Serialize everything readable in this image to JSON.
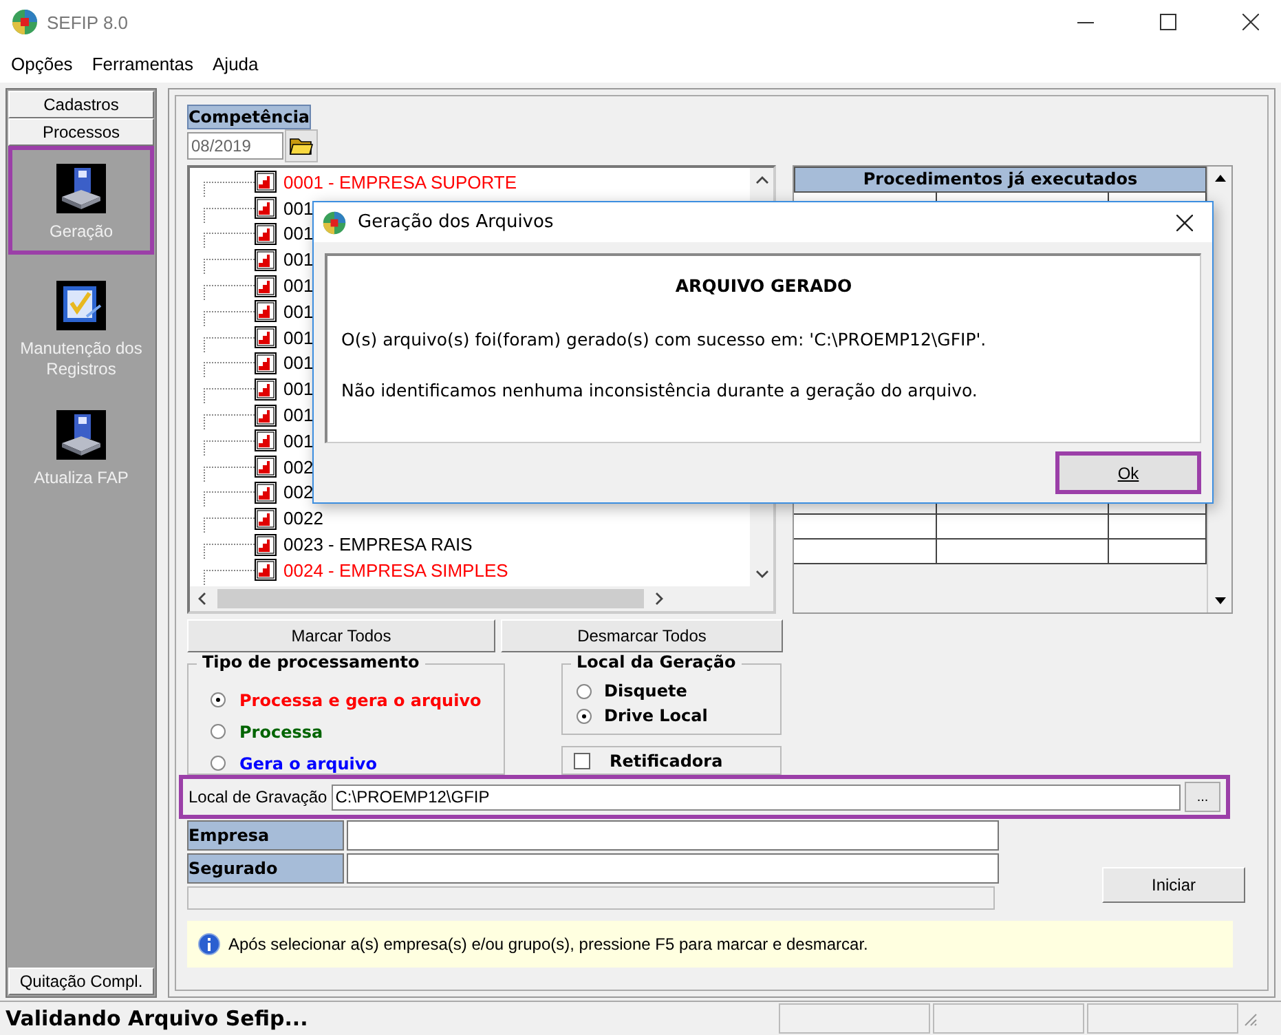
{
  "window": {
    "title": "SEFIP 8.0"
  },
  "menu": [
    "Opções",
    "Ferramentas",
    "Ajuda"
  ],
  "sidebar": {
    "tabs": [
      "Cadastros",
      "Processos"
    ],
    "items": [
      {
        "label": "Geração",
        "selected": true
      },
      {
        "label": "Manutenção dos Registros",
        "selected": false
      },
      {
        "label": "Atualiza FAP",
        "selected": false
      }
    ],
    "bottom_tab": "Quitação Compl."
  },
  "competencia": {
    "label": "Competência",
    "value": "08/2019"
  },
  "company_list": [
    {
      "text": "0001 - EMPRESA SUPORTE",
      "color": "#ff0000"
    },
    {
      "text": "001",
      "color": "#000000"
    },
    {
      "text": "001",
      "color": "#000000"
    },
    {
      "text": "001",
      "color": "#000000"
    },
    {
      "text": "001",
      "color": "#000000"
    },
    {
      "text": "001",
      "color": "#000000"
    },
    {
      "text": "001",
      "color": "#000000"
    },
    {
      "text": "001",
      "color": "#000000"
    },
    {
      "text": "001",
      "color": "#000000"
    },
    {
      "text": "001",
      "color": "#000000"
    },
    {
      "text": "001",
      "color": "#000000"
    },
    {
      "text": "002",
      "color": "#000000"
    },
    {
      "text": "002",
      "color": "#000000"
    },
    {
      "text": "0022",
      "color": "#000000"
    },
    {
      "text": "0023 - EMPRESA RAIS",
      "color": "#000000"
    },
    {
      "text": "0024 - EMPRESA SIMPLES",
      "color": "#ff0000"
    }
  ],
  "procedures": {
    "title": "Procedimentos já executados"
  },
  "list_buttons": [
    "Marcar Todos",
    "Desmarcar Todos"
  ],
  "tipo_processamento": {
    "title": "Tipo de processamento",
    "options": [
      {
        "label": "Processa e gera o arquivo",
        "color": "#ff0000",
        "selected": true
      },
      {
        "label": "Processa",
        "color": "#006400",
        "selected": false
      },
      {
        "label": "Gera o arquivo",
        "color": "#0000ff",
        "selected": false
      }
    ]
  },
  "local_geracao": {
    "title": "Local da Geração",
    "options": [
      {
        "label": "Disquete",
        "selected": false
      },
      {
        "label": "Drive Local",
        "selected": true
      }
    ]
  },
  "retificadora": {
    "label": "Retificadora",
    "checked": false
  },
  "local_gravacao": {
    "label": "Local de Gravação",
    "value": "C:\\PROEMP12\\GFIP",
    "browse": "...",
    "highlighted": true
  },
  "fields": [
    {
      "label": "Empresa"
    },
    {
      "label": "Segurado"
    }
  ],
  "progress": {
    "level": 0
  },
  "start_button": "Iniciar",
  "info": "Após selecionar a(s) empresa(s) e/ou grupo(s), pressione F5 para marcar e desmarcar.",
  "status_bar": "Validando Arquivo Sefip...",
  "dialog": {
    "title": "Geração dos Arquivos",
    "heading": "ARQUIVO GERADO",
    "lines": [
      "O(s) arquivo(s) foi(foram) gerado(s) com sucesso em: 'C:\\PROEMP12\\GFIP'.",
      "Não identificamos nenhuma inconsistência durante a geração do arquivo."
    ],
    "ok": {
      "label": "Ok",
      "highlighted": true
    }
  }
}
